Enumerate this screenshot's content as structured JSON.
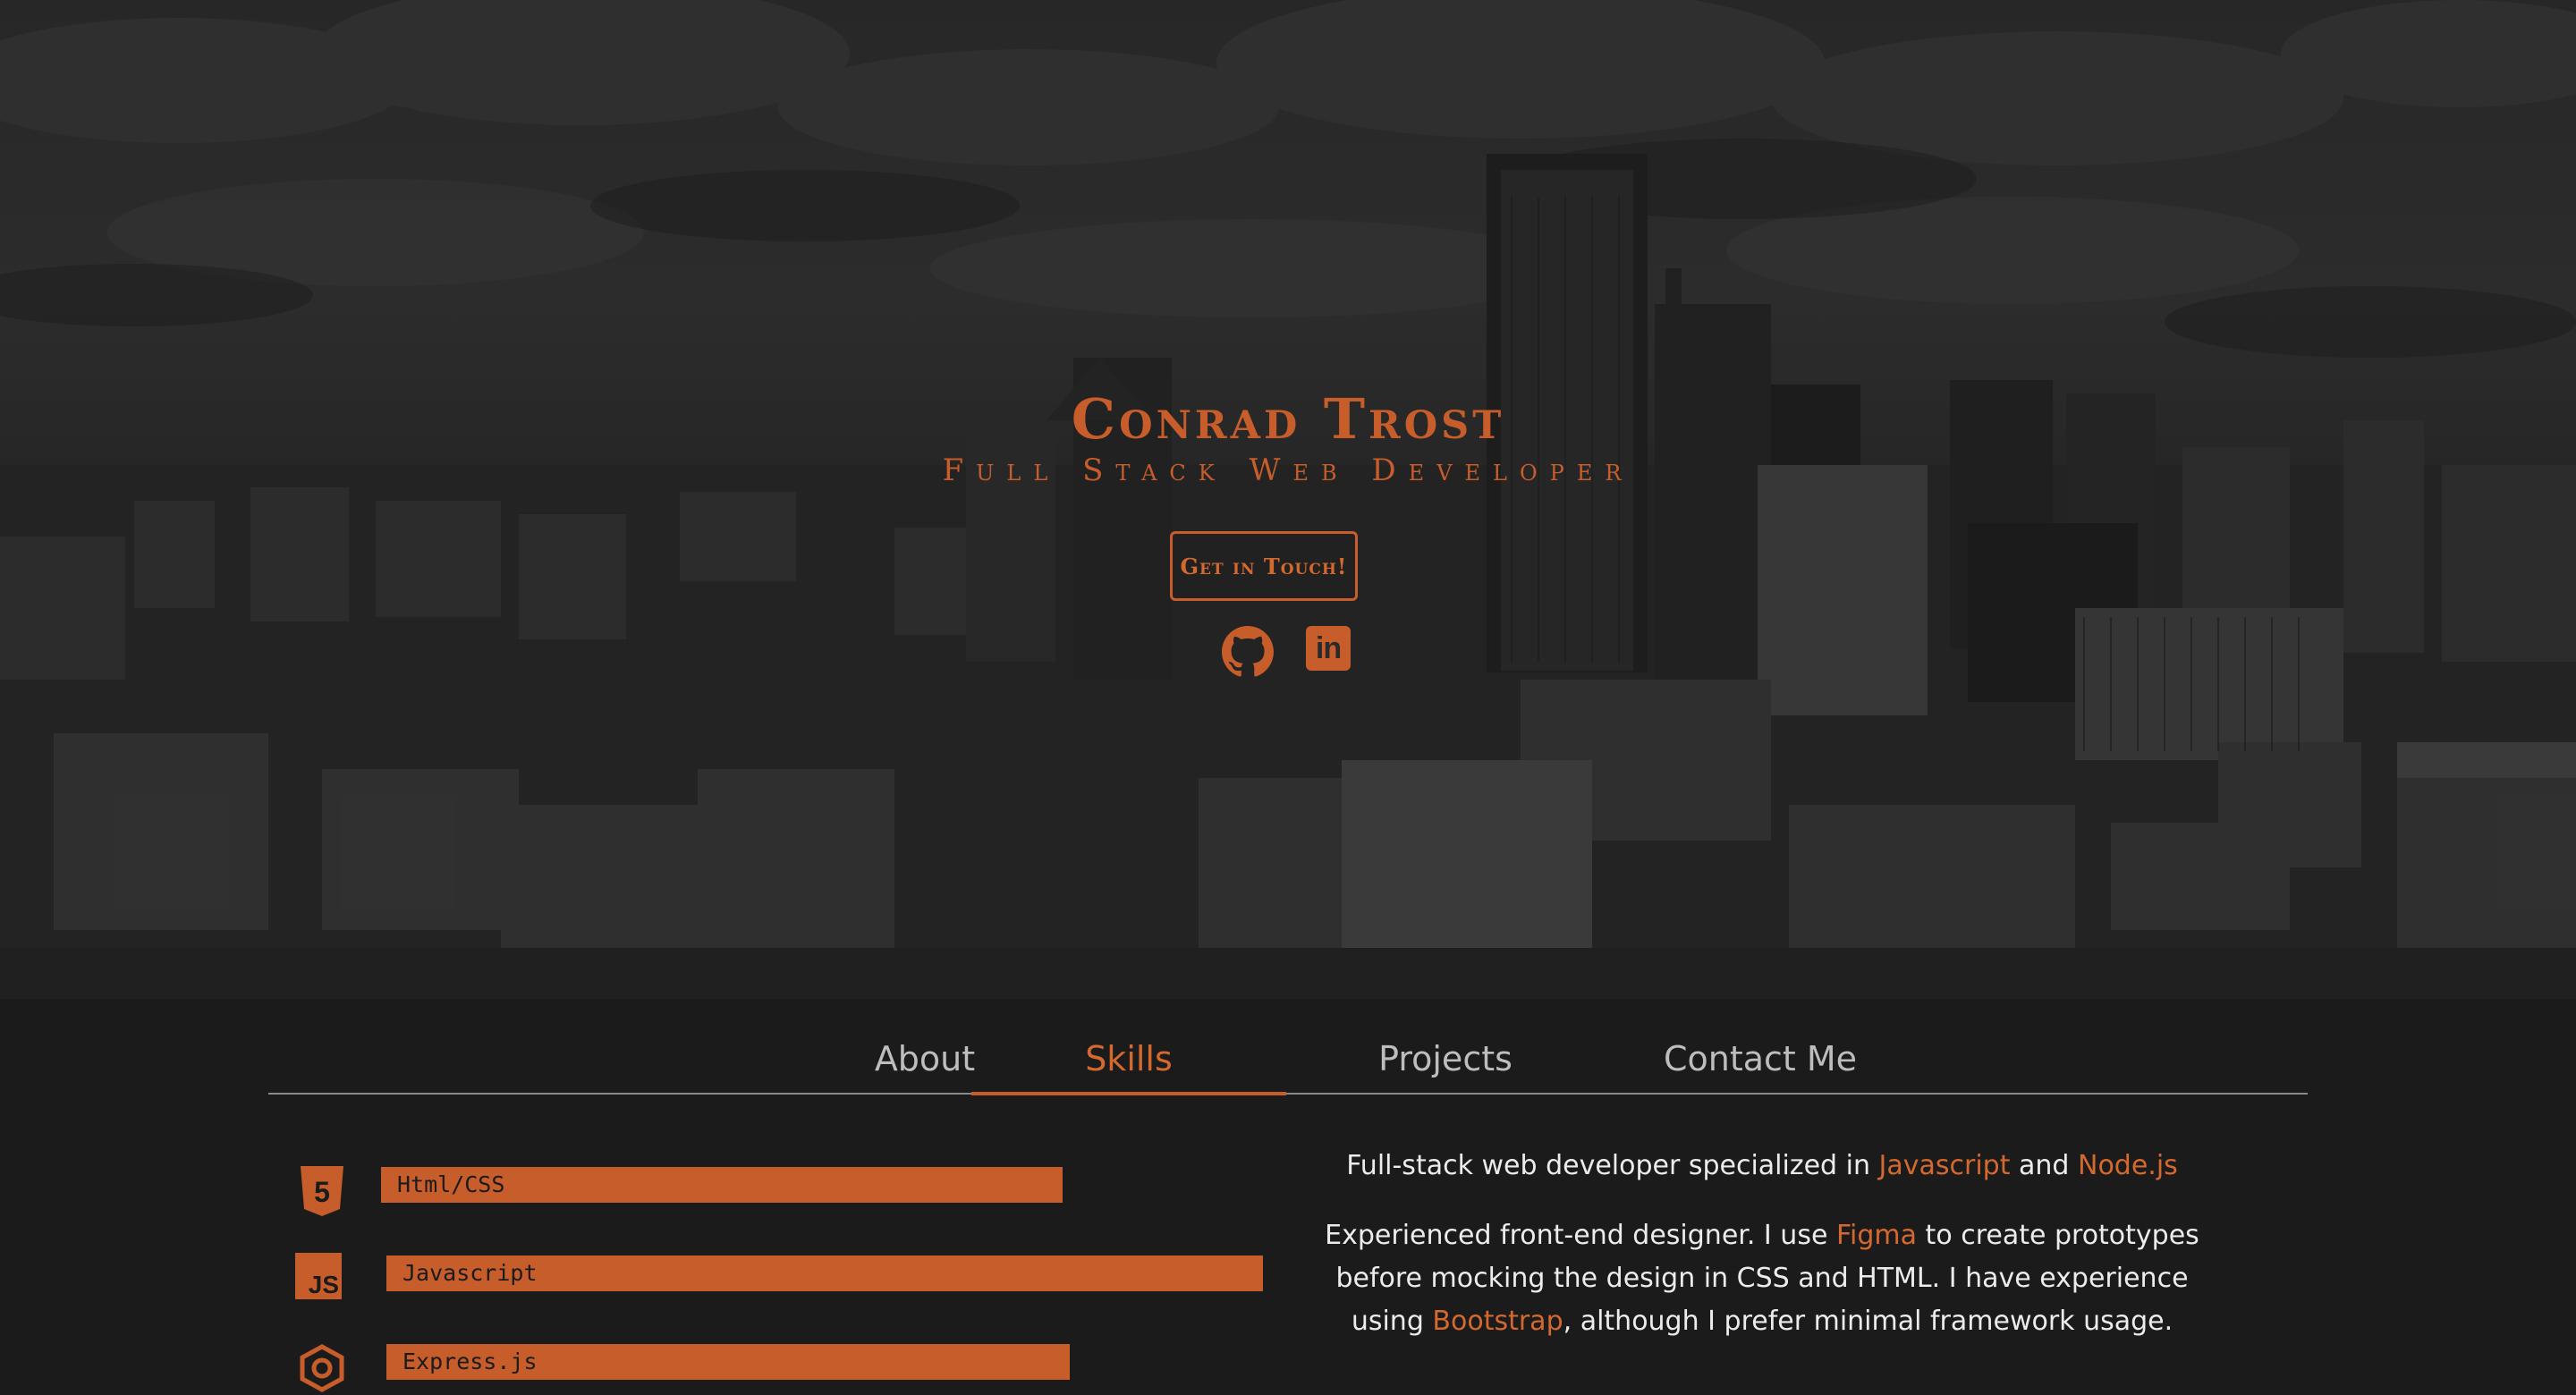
{
  "hero": {
    "name": "Conrad Trost",
    "subtitle": "Full Stack Web Developer",
    "cta_label": "Get in Touch!"
  },
  "social": [
    {
      "icon": "github-icon"
    },
    {
      "icon": "linkedin-icon",
      "label": "in"
    }
  ],
  "nav": {
    "tabs": [
      {
        "label": "About",
        "active": false
      },
      {
        "label": "Skills",
        "active": true
      },
      {
        "label": "Projects",
        "active": false
      },
      {
        "label": "Contact Me",
        "active": false
      }
    ]
  },
  "skills": [
    {
      "name": "Html/CSS",
      "icon": "html5-icon",
      "badge": "5"
    },
    {
      "name": "Javascript",
      "icon": "javascript-icon",
      "badge": "JS"
    },
    {
      "name": "Express.js",
      "icon": "express-icon"
    }
  ],
  "about": {
    "p1": {
      "pre": "Full-stack web developer specialized in ",
      "link1": "Javascript",
      "mid": " and ",
      "link2": "Node.js"
    },
    "p2": {
      "pre": "Experienced front-end designer. I use ",
      "link1": "Figma",
      "mid": " to create prototypes before mocking the design in CSS and HTML. I have experience using ",
      "link2": "Bootstrap",
      "post": ", although I prefer minimal framework usage."
    }
  },
  "colors": {
    "accent": "#c65d2a",
    "background": "#1b1b1b",
    "text": "#e6e6e6"
  }
}
